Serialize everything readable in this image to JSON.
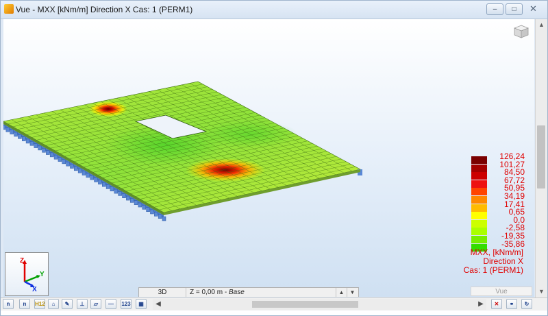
{
  "window": {
    "title": "Vue - MXX [kNm/m] Direction X Cas: 1 (PERM1)",
    "controls": {
      "minimize": "–",
      "maximize": "□",
      "close": "✕"
    }
  },
  "legend": {
    "entries": [
      {
        "value": "126,24",
        "color": "#7a0000"
      },
      {
        "value": "101,27",
        "color": "#a40000"
      },
      {
        "value": "84,50",
        "color": "#cc0000"
      },
      {
        "value": "67,72",
        "color": "#ee1111"
      },
      {
        "value": "50,95",
        "color": "#ff4400"
      },
      {
        "value": "34,19",
        "color": "#ff8800"
      },
      {
        "value": "17,41",
        "color": "#ffbb00"
      },
      {
        "value": "0,65",
        "color": "#ffff00"
      },
      {
        "value": "0,0",
        "color": "#ccff00"
      },
      {
        "value": "-2,58",
        "color": "#aaff00"
      },
      {
        "value": "-19,35",
        "color": "#77ee00"
      },
      {
        "value": "-35,86",
        "color": "#33dd00"
      }
    ],
    "caption_line1": "MXX, [kNm/m]",
    "caption_line2": "Direction X",
    "caption_line3": "Cas: 1 (PERM1)"
  },
  "axes": {
    "x": "X",
    "y": "Y",
    "z": "Z"
  },
  "statusbar": {
    "mode": "3D",
    "level_prefix": "Z = 0,00 m - ",
    "level_name": "Base"
  },
  "view_tab": "Vue",
  "toolbar": {
    "buttons": [
      "n",
      "n",
      "H12",
      "",
      "",
      "",
      "",
      "",
      "123",
      ""
    ]
  },
  "colors": {
    "result_label": "#e00000",
    "slab_base": "#9fe33a",
    "support": "#4a78c8"
  }
}
